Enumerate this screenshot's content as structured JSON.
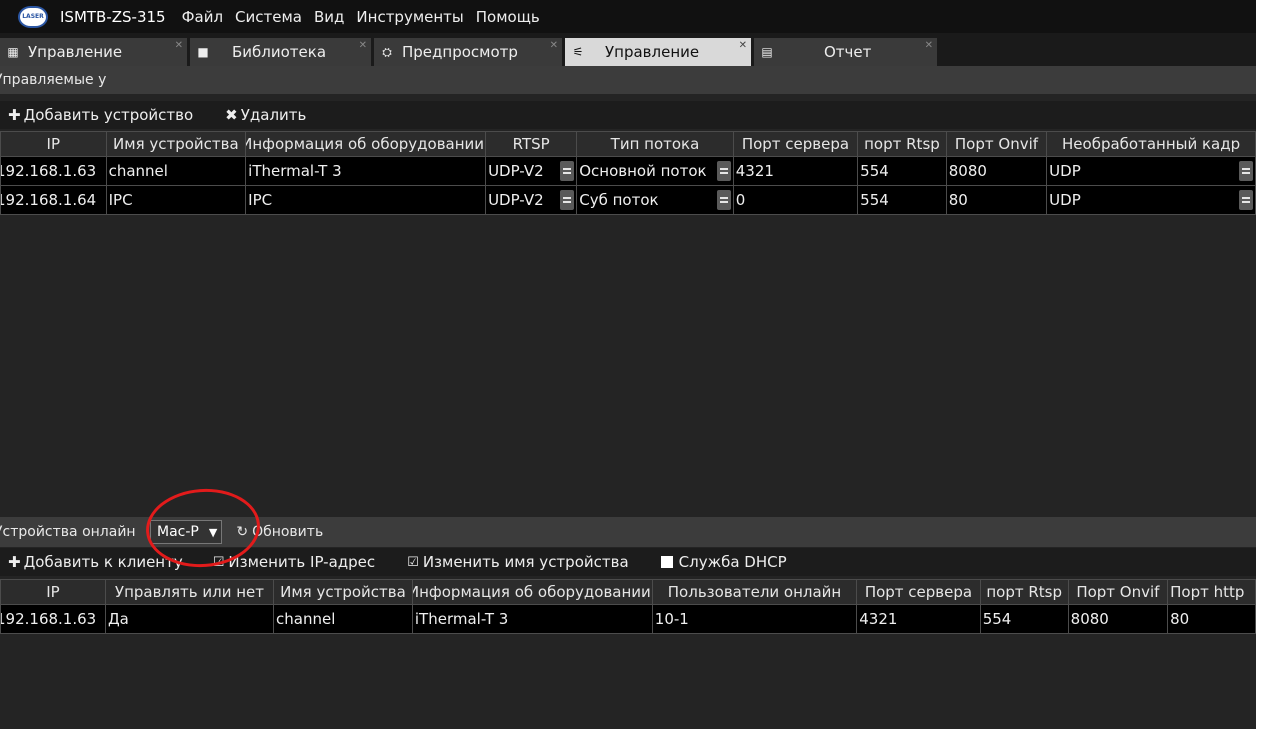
{
  "window": {
    "logo_text": "LASER",
    "title": "ISMTB-ZS-315"
  },
  "menu": [
    "Файл",
    "Система",
    "Вид",
    "Инструменты",
    "Помощь"
  ],
  "tabs": [
    {
      "label": "Управление",
      "icon": "grid-icon",
      "glyph": "▦",
      "active": false
    },
    {
      "label": "Библиотека",
      "icon": "folder-icon",
      "glyph": "■",
      "active": false
    },
    {
      "label": "Предпросмотр",
      "icon": "camera-icon",
      "glyph": "⛭",
      "active": false
    },
    {
      "label": "Управление",
      "icon": "satellite-icon",
      "glyph": "⚟",
      "active": true
    },
    {
      "label": "Отчет",
      "icon": "report-icon",
      "glyph": "▤",
      "active": false
    }
  ],
  "managed": {
    "header": "Управляемые у",
    "toolbar": {
      "add": "Добавить устройство",
      "delete": "Удалить"
    },
    "columns": [
      "IP",
      "Имя устройства",
      "Информация об оборудовании",
      "RTSP",
      "Тип потока",
      "Порт сервера",
      "порт Rtsp",
      "Порт Onvif",
      "Необработанный кадр"
    ],
    "rows": [
      {
        "ip": "192.168.1.63",
        "name": "channel",
        "info": "iThermal-T 3",
        "rtsp": "UDP-V2",
        "stream": "Основной поток",
        "server_port": "4321",
        "rtsp_port": "554",
        "onvif_port": "8080",
        "raw": "UDP"
      },
      {
        "ip": "192.168.1.64",
        "name": "IPC",
        "info": "IPC",
        "rtsp": "UDP-V2",
        "stream": "Суб поток",
        "server_port": "0",
        "rtsp_port": "554",
        "onvif_port": "80",
        "raw": "UDP"
      }
    ]
  },
  "online": {
    "header": "Устройства онлайн",
    "filter_value": "Mac-P",
    "refresh": "Обновить",
    "toolbar": {
      "add_client": "Добавить к клиенту",
      "change_ip": "Изменить IP-адрес",
      "change_name": "Изменить имя устройства",
      "dhcp": "Служба DHCP"
    },
    "columns": [
      "IP",
      "Управлять или нет",
      "Имя устройства",
      "Информация об оборудовании",
      "Пользователи онлайн",
      "Порт сервера",
      "порт Rtsp",
      "Порт Onvif",
      "Порт http"
    ],
    "rows": [
      {
        "ip": "192.168.1.63",
        "managed": "Да",
        "name": "channel",
        "info": "iThermal-T 3",
        "users": "10-1",
        "server_port": "4321",
        "rtsp_port": "554",
        "onvif_port": "8080",
        "http_port": "80"
      }
    ]
  },
  "colors": {
    "annotation_circle": "#e21b1b",
    "active_tab": "#d9d9d9"
  }
}
